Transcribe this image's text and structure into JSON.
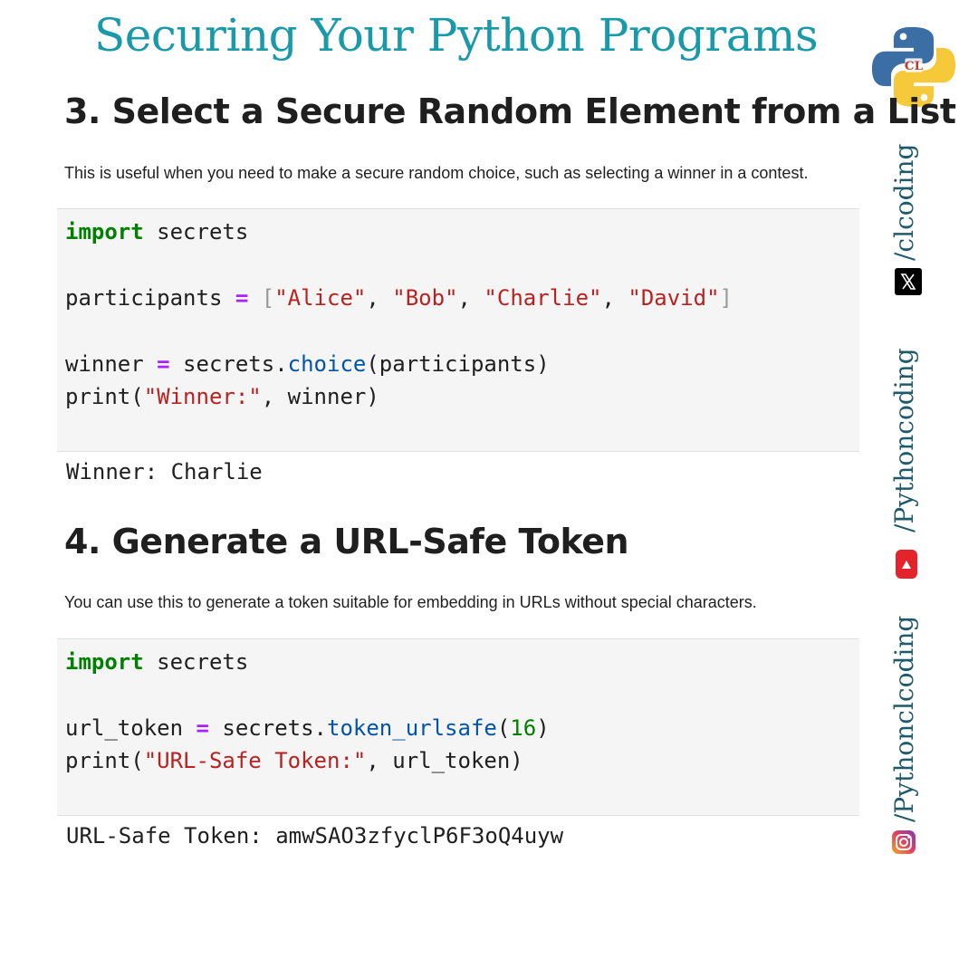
{
  "banner": {
    "title": "Securing Your Python Programs"
  },
  "section3": {
    "heading": "3. Select a Secure Random Element from a List",
    "description": "This is useful when you need to make a secure random choice, such as selecting a winner in a contest.",
    "code": {
      "line1_kw": "import",
      "line1_rest": " secrets",
      "line2_name": "participants ",
      "line2_op": "=",
      "line2_open": "[",
      "s_alice": "\"Alice\"",
      "s_bob": "\"Bob\"",
      "s_charlie": "\"Charlie\"",
      "s_david": "\"David\"",
      "comma": ", ",
      "line2_close": "]",
      "line3_name": "winner ",
      "line3_op": "=",
      "line3_obj": " secrets.",
      "line3_fn": "choice",
      "line3_args": "(participants)",
      "line4_fn": "print(",
      "line4_str": "\"Winner:\"",
      "line4_rest": ", winner)"
    },
    "output": "Winner: Charlie"
  },
  "section4": {
    "heading": "4. Generate a URL-Safe Token",
    "description": "You can use this to generate a token suitable for embedding in URLs without special characters.",
    "code": {
      "line1_kw": "import",
      "line1_rest": " secrets",
      "line2_name": "url_token ",
      "line2_op": "=",
      "line2_obj": " secrets.",
      "line2_fn": "token_urlsafe",
      "line2_open": "(",
      "line2_num": "16",
      "line2_close": ")",
      "line3_fn": "print(",
      "line3_str": "\"URL-Safe Token:\"",
      "line3_rest": ", url_token)"
    },
    "output": "URL-Safe Token: amwSAO3zfyclP6F3oQ4uyw"
  },
  "social": {
    "x_handle": "/clcoding",
    "youtube_handle": "/Pythoncoding",
    "instagram_handle": "/Pythonclcoding",
    "x_icon": "x-logo-icon",
    "youtube_icon": "youtube-icon",
    "instagram_icon": "instagram-icon"
  },
  "colors": {
    "banner": "#1a9aa8",
    "keyword": "#008000",
    "operator": "#aa22ff",
    "string": "#ba2121",
    "function": "#0055aa",
    "code_bg": "#f5f5f5"
  }
}
